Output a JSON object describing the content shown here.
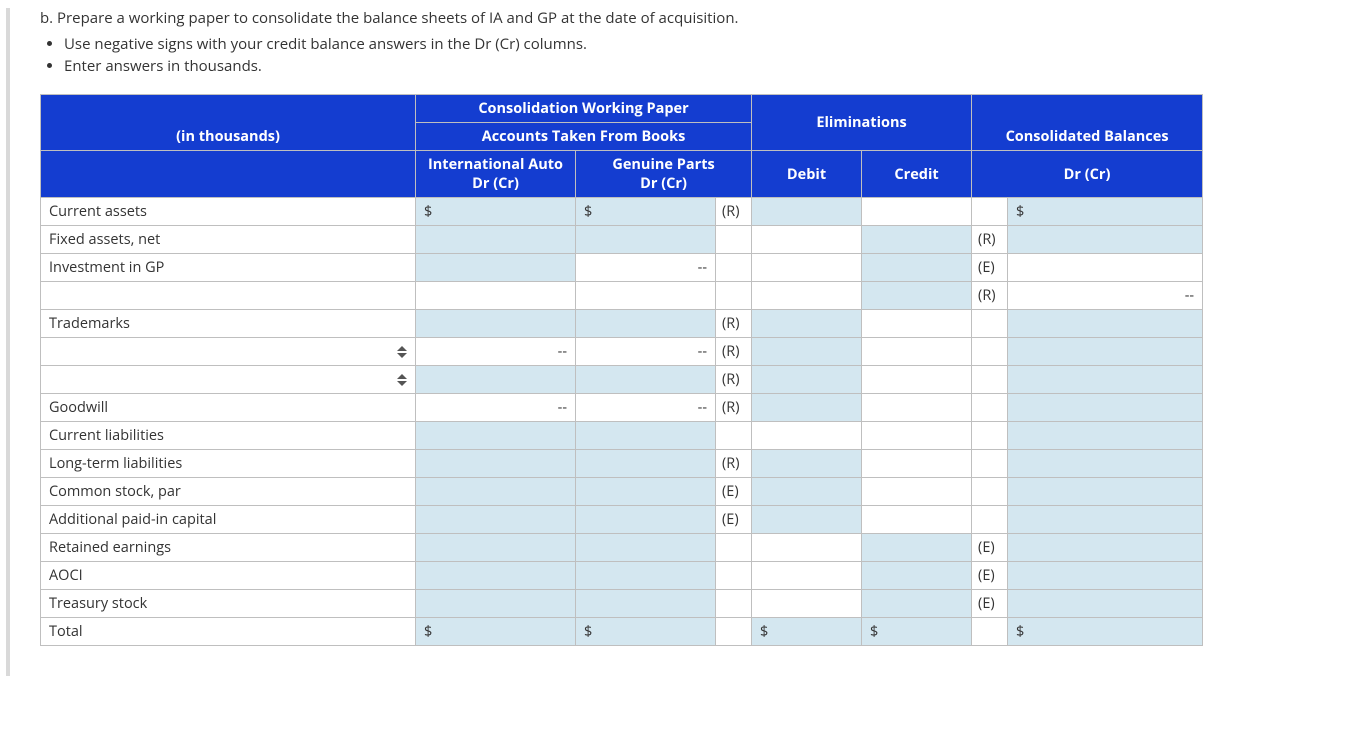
{
  "prompt": "b. Prepare a working paper to consolidate the balance sheets of  IA and GP at the date of acquisition.",
  "bullets": [
    "Use negative signs with your credit balance answers in the Dr (Cr) columns.",
    "Enter answers in thousands."
  ],
  "header": {
    "title": "Consolidation Working Paper",
    "accounts_taken": "Accounts Taken From Books",
    "eliminations": "Eliminations",
    "in_thousands": "(in thousands)",
    "ia": "International Auto",
    "ia_drcr": "Dr (Cr)",
    "gp": "Genuine Parts",
    "gp_drcr": "Dr (Cr)",
    "debit": "Debit",
    "credit": "Credit",
    "consol": "Consolidated Balances",
    "consol_drcr": "Dr (Cr)"
  },
  "rows": [
    {
      "label": "Current assets",
      "ia_prefix": "$",
      "ia_editable": true,
      "gp_prefix": "$",
      "gp_text": "",
      "gp_editable": true,
      "tag1": "(R)",
      "debit_editable": true,
      "credit_editable": false,
      "tag2": "",
      "cons_prefix": "$",
      "cons_editable": true,
      "cons_text": "",
      "sortable": false
    },
    {
      "label": "Fixed assets, net",
      "ia_prefix": "",
      "ia_editable": true,
      "gp_prefix": "",
      "gp_text": "",
      "gp_editable": true,
      "tag1": "",
      "debit_editable": false,
      "credit_editable": true,
      "tag2": "(R)",
      "cons_prefix": "",
      "cons_editable": true,
      "cons_text": "",
      "sortable": false
    },
    {
      "label": "Investment in GP",
      "ia_prefix": "",
      "ia_editable": true,
      "gp_prefix": "",
      "gp_text": "--",
      "gp_editable": false,
      "tag1": "",
      "debit_editable": false,
      "credit_editable": true,
      "tag2": "(E)",
      "cons_prefix": "",
      "cons_editable": false,
      "cons_text": "",
      "sortable": false
    },
    {
      "label": "",
      "ia_prefix": "",
      "ia_editable": false,
      "gp_prefix": "",
      "gp_text": "",
      "gp_editable": false,
      "tag1": "",
      "debit_editable": false,
      "credit_editable": true,
      "tag2": "(R)",
      "cons_prefix": "",
      "cons_editable": false,
      "cons_text": "--",
      "sortable": false
    },
    {
      "label": "Trademarks",
      "ia_prefix": "",
      "ia_editable": true,
      "gp_prefix": "",
      "gp_text": "",
      "gp_editable": true,
      "tag1": "(R)",
      "debit_editable": true,
      "credit_editable": false,
      "tag2": "",
      "cons_prefix": "",
      "cons_editable": true,
      "cons_text": "",
      "sortable": false
    },
    {
      "label": "",
      "ia_prefix": "",
      "ia_editable": false,
      "ia_text": "--",
      "gp_prefix": "",
      "gp_text": "--",
      "gp_editable": false,
      "tag1": "(R)",
      "debit_editable": true,
      "credit_editable": false,
      "tag2": "",
      "cons_prefix": "",
      "cons_editable": true,
      "cons_text": "",
      "sortable": true
    },
    {
      "label": "",
      "ia_prefix": "",
      "ia_editable": true,
      "gp_prefix": "",
      "gp_text": "",
      "gp_editable": true,
      "tag1": "(R)",
      "debit_editable": true,
      "credit_editable": false,
      "tag2": "",
      "cons_prefix": "",
      "cons_editable": true,
      "cons_text": "",
      "sortable": true
    },
    {
      "label": "Goodwill",
      "ia_prefix": "",
      "ia_editable": false,
      "ia_text": "--",
      "gp_prefix": "",
      "gp_text": "--",
      "gp_editable": false,
      "tag1": "(R)",
      "debit_editable": true,
      "credit_editable": false,
      "tag2": "",
      "cons_prefix": "",
      "cons_editable": true,
      "cons_text": "",
      "sortable": false
    },
    {
      "label": "Current liabilities",
      "ia_prefix": "",
      "ia_editable": true,
      "gp_prefix": "",
      "gp_text": "",
      "gp_editable": true,
      "tag1": "",
      "debit_editable": false,
      "credit_editable": false,
      "tag2": "",
      "cons_prefix": "",
      "cons_editable": true,
      "cons_text": "",
      "sortable": false
    },
    {
      "label": "Long-term liabilities",
      "ia_prefix": "",
      "ia_editable": true,
      "gp_prefix": "",
      "gp_text": "",
      "gp_editable": true,
      "tag1": "(R)",
      "debit_editable": true,
      "credit_editable": false,
      "tag2": "",
      "cons_prefix": "",
      "cons_editable": true,
      "cons_text": "",
      "sortable": false
    },
    {
      "label": "Common stock, par",
      "ia_prefix": "",
      "ia_editable": true,
      "gp_prefix": "",
      "gp_text": "",
      "gp_editable": true,
      "tag1": "(E)",
      "debit_editable": true,
      "credit_editable": false,
      "tag2": "",
      "cons_prefix": "",
      "cons_editable": true,
      "cons_text": "",
      "sortable": false
    },
    {
      "label": "Additional paid-in capital",
      "ia_prefix": "",
      "ia_editable": true,
      "gp_prefix": "",
      "gp_text": "",
      "gp_editable": true,
      "tag1": "(E)",
      "debit_editable": true,
      "credit_editable": false,
      "tag2": "",
      "cons_prefix": "",
      "cons_editable": true,
      "cons_text": "",
      "sortable": false
    },
    {
      "label": "Retained earnings",
      "ia_prefix": "",
      "ia_editable": true,
      "gp_prefix": "",
      "gp_text": "",
      "gp_editable": true,
      "tag1": "",
      "debit_editable": false,
      "credit_editable": true,
      "tag2": "(E)",
      "cons_prefix": "",
      "cons_editable": true,
      "cons_text": "",
      "sortable": false
    },
    {
      "label": "AOCI",
      "ia_prefix": "",
      "ia_editable": true,
      "gp_prefix": "",
      "gp_text": "",
      "gp_editable": true,
      "tag1": "",
      "debit_editable": false,
      "credit_editable": true,
      "tag2": "(E)",
      "cons_prefix": "",
      "cons_editable": true,
      "cons_text": "",
      "sortable": false
    },
    {
      "label": "Treasury stock",
      "ia_prefix": "",
      "ia_editable": true,
      "gp_prefix": "",
      "gp_text": "",
      "gp_editable": true,
      "tag1": "",
      "debit_editable": false,
      "credit_editable": true,
      "tag2": "(E)",
      "cons_prefix": "",
      "cons_editable": true,
      "cons_text": "",
      "sortable": false
    },
    {
      "label": "Total",
      "ia_prefix": "$",
      "ia_editable": true,
      "gp_prefix": "$",
      "gp_text": "",
      "gp_editable": true,
      "tag1": "",
      "debit_editable": true,
      "debit_prefix": "$",
      "credit_editable": true,
      "credit_prefix": "$",
      "tag2": "",
      "cons_prefix": "$",
      "cons_editable": true,
      "cons_text": "",
      "sortable": false,
      "is_total": true
    }
  ]
}
